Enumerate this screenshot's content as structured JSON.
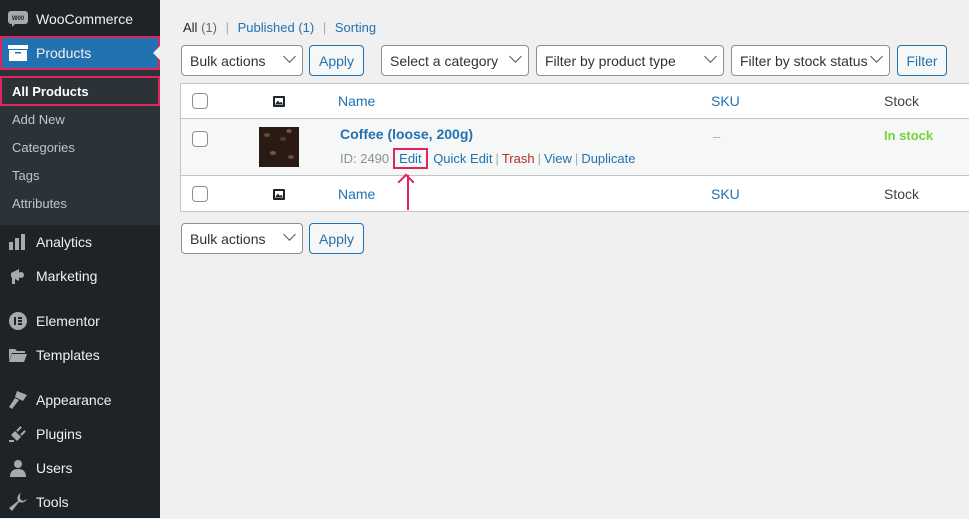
{
  "sidebar": {
    "woocommerce": {
      "label": "WooCommerce",
      "icon": "woo-icon"
    },
    "products": {
      "label": "Products",
      "icon": "archive-icon"
    },
    "submenu": [
      {
        "label": "All Products"
      },
      {
        "label": "Add New"
      },
      {
        "label": "Categories"
      },
      {
        "label": "Tags"
      },
      {
        "label": "Attributes"
      }
    ],
    "items": [
      {
        "label": "Analytics",
        "icon": "chart-bar-icon"
      },
      {
        "label": "Marketing",
        "icon": "megaphone-icon"
      },
      {
        "label": "Elementor",
        "icon": "elementor-icon"
      },
      {
        "label": "Templates",
        "icon": "folder-icon"
      },
      {
        "label": "Appearance",
        "icon": "paintbrush-icon"
      },
      {
        "label": "Plugins",
        "icon": "plug-icon"
      },
      {
        "label": "Users",
        "icon": "user-icon"
      },
      {
        "label": "Tools",
        "icon": "wrench-icon"
      }
    ]
  },
  "views": {
    "all": "All",
    "all_count": "(1)",
    "published": "Published (1)",
    "sorting": "Sorting",
    "sep": "|"
  },
  "toolbar_top": {
    "bulk_actions": "Bulk actions",
    "apply": "Apply",
    "category": "Select a category",
    "product_type": "Filter by product type",
    "stock_status": "Filter by stock status",
    "filter": "Filter"
  },
  "table": {
    "columns": {
      "name": "Name",
      "sku": "SKU",
      "stock": "Stock"
    },
    "rows": [
      {
        "name": "Coffee (loose, 200g)",
        "id": "ID: 2490",
        "actions": {
          "edit": "Edit",
          "quick_edit": "Quick Edit",
          "trash": "Trash",
          "view": "View",
          "duplicate": "Duplicate"
        },
        "sku": "–",
        "stock": "In stock"
      }
    ]
  },
  "toolbar_bottom": {
    "bulk_actions": "Bulk actions",
    "apply": "Apply"
  },
  "colors": {
    "accent": "#2271b1",
    "highlight": "#e0245e",
    "in_stock": "#7ad03a",
    "trash": "#b32d2e"
  }
}
